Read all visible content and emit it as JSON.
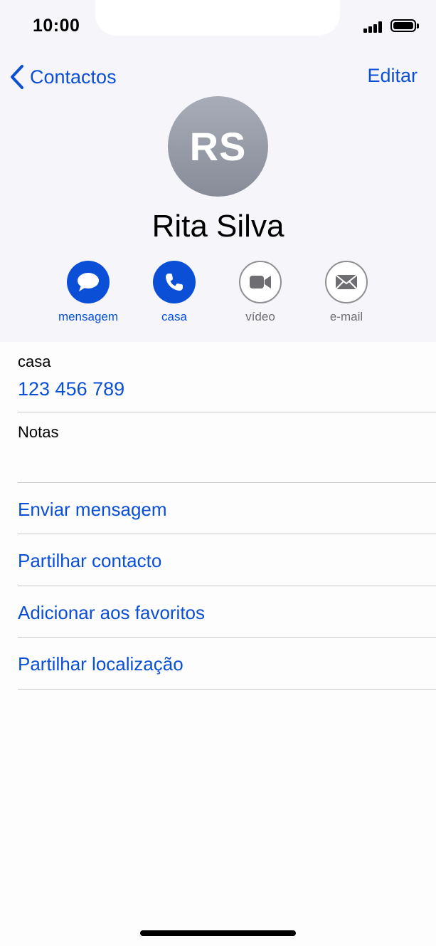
{
  "status_bar": {
    "time": "10:00"
  },
  "nav": {
    "back_label": "Contactos",
    "edit_label": "Editar"
  },
  "contact": {
    "initials": "RS",
    "name": "Rita Silva"
  },
  "actions": [
    {
      "label": "mensagem",
      "icon": "message-bubble-icon",
      "active": true
    },
    {
      "label": "casa",
      "icon": "phone-icon",
      "active": true
    },
    {
      "label": "vídeo",
      "icon": "video-camera-icon",
      "active": false
    },
    {
      "label": "e-mail",
      "icon": "envelope-icon",
      "active": false
    }
  ],
  "phone": {
    "label": "casa",
    "number": "123 456 789"
  },
  "notes": {
    "label": "Notas"
  },
  "menu": [
    "Enviar mensagem",
    "Partilhar contacto",
    "Adicionar aos favoritos",
    "Partilhar localização"
  ],
  "colors": {
    "accent": "#0a4fd6",
    "header_bg": "#f6f6fa",
    "inactive_icon": "#6d6d72"
  }
}
